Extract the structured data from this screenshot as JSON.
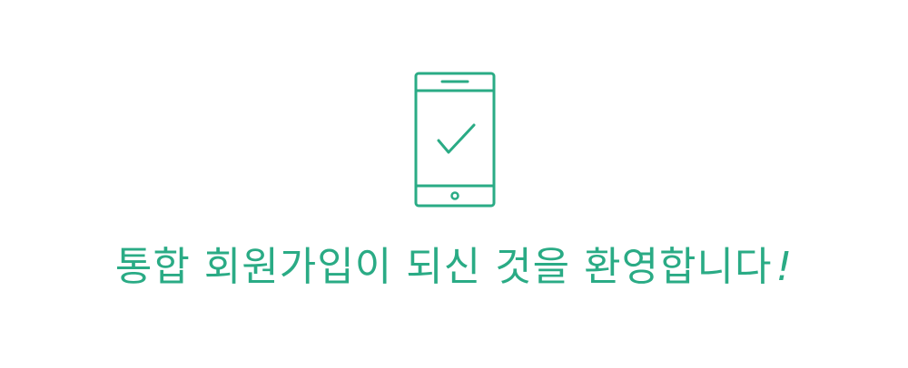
{
  "colors": {
    "accent": "#2aab85",
    "background": "#ffffff"
  },
  "illustration": {
    "icon": "smartphone-check-icon"
  },
  "welcome": {
    "message": "통합 회원가입이 되신 것을 환영합니다",
    "exclamation": "!"
  }
}
